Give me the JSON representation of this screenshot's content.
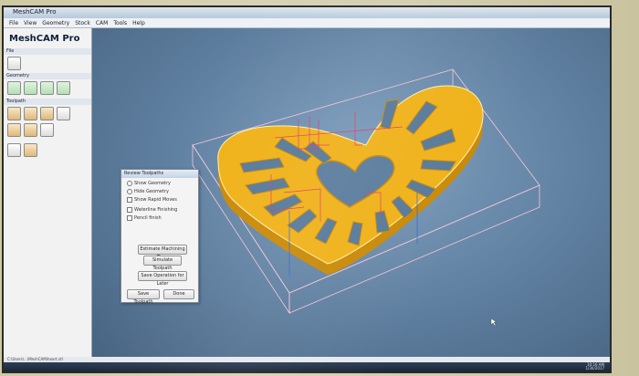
{
  "window": {
    "title": "MeshCAM Pro"
  },
  "menu": [
    "File",
    "View",
    "Geometry",
    "Stock",
    "CAM",
    "Tools",
    "Help"
  ],
  "sidebar": {
    "brand": "MeshCAM Pro",
    "sections": [
      {
        "label": "File"
      },
      {
        "label": "Geometry"
      },
      {
        "label": "Toolpath"
      }
    ]
  },
  "dialog": {
    "title": "Review Toolpaths",
    "options": [
      {
        "label": "Show Geometry",
        "kind": "radio"
      },
      {
        "label": "Hide Geometry",
        "kind": "radio"
      },
      {
        "label": "Show Rapid Moves",
        "kind": "check"
      },
      {
        "label": "Waterline Finishing",
        "kind": "check"
      },
      {
        "label": "Pencil finish",
        "kind": "check"
      }
    ],
    "buttons": {
      "estimate": "Estimate Machining Time",
      "simulate": "Simulate Toolpath",
      "save_ops": "Save Operation for Later",
      "save_toolpath": "Save Toolpath",
      "done": "Done"
    }
  },
  "status": {
    "path": "C:\\Users\\...\\MeshCAM\\heart.stl"
  },
  "tray": {
    "time": "10:16 AM",
    "date": "1/30/2017"
  },
  "colors": {
    "part": "#f0b21a",
    "part_edge": "#c98a08",
    "toolpath": "#e23a6a",
    "stock": "#f2c6d6"
  }
}
